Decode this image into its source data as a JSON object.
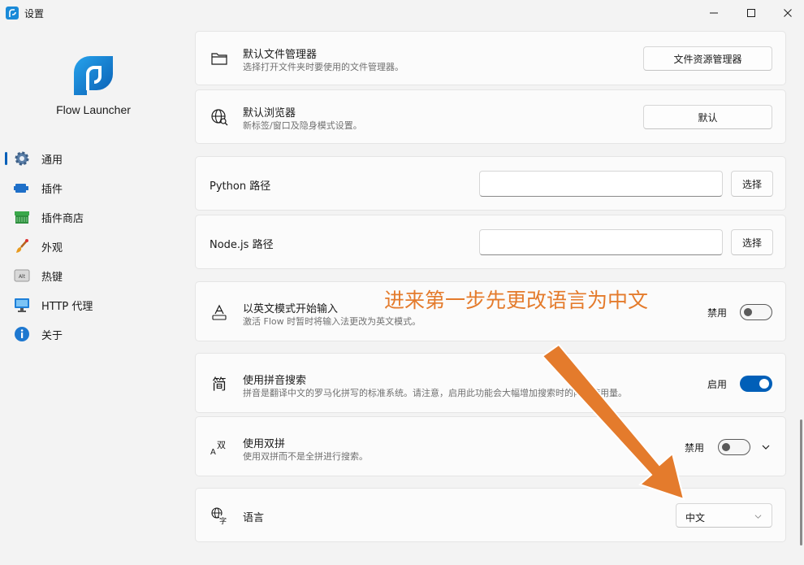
{
  "window": {
    "title": "设置"
  },
  "brand": {
    "name": "Flow Launcher"
  },
  "nav": [
    {
      "label": "通用",
      "icon": "gear-icon"
    },
    {
      "label": "插件",
      "icon": "plugin-icon"
    },
    {
      "label": "插件商店",
      "icon": "store-icon"
    },
    {
      "label": "外观",
      "icon": "brush-icon"
    },
    {
      "label": "热键",
      "icon": "keyboard-icon"
    },
    {
      "label": "HTTP 代理",
      "icon": "monitor-icon"
    },
    {
      "label": "关于",
      "icon": "info-icon"
    }
  ],
  "settings": {
    "file_manager": {
      "title": "默认文件管理器",
      "desc": "选择打开文件夹时要使用的文件管理器。",
      "button": "文件资源管理器",
      "icon": "folder-icon"
    },
    "browser": {
      "title": "默认浏览器",
      "desc": "新标签/窗口及隐身模式设置。",
      "button": "默认",
      "icon": "globe-icon"
    },
    "python": {
      "label": "Python 路径",
      "value": "",
      "button": "选择"
    },
    "nodejs": {
      "label": "Node.js 路径",
      "value": "",
      "button": "选择"
    },
    "english_mode": {
      "title": "以英文模式开始输入",
      "desc": "激活 Flow 时暂时将输入法更改为英文模式。",
      "state_label": "禁用",
      "on": false,
      "icon": "text-a-icon"
    },
    "pinyin": {
      "title": "使用拼音搜索",
      "desc": "拼音是翻译中文的罗马化拼写的标准系统。请注意，启用此功能会大幅增加搜索时的内存使用量。",
      "state_label": "启用",
      "on": true,
      "icon": "jian-char-icon"
    },
    "double_pinyin": {
      "title": "使用双拼",
      "desc": "使用双拼而不是全拼进行搜索。",
      "state_label": "禁用",
      "on": false,
      "icon": "shuang-char-icon"
    },
    "language": {
      "label": "语言",
      "value": "中文",
      "icon": "translate-icon"
    }
  },
  "annotation": {
    "text": "进来第一步先更改语言为中文",
    "color": "#e47b2c"
  },
  "colors": {
    "accent": "#005fb8",
    "annotation": "#e47b2c"
  }
}
